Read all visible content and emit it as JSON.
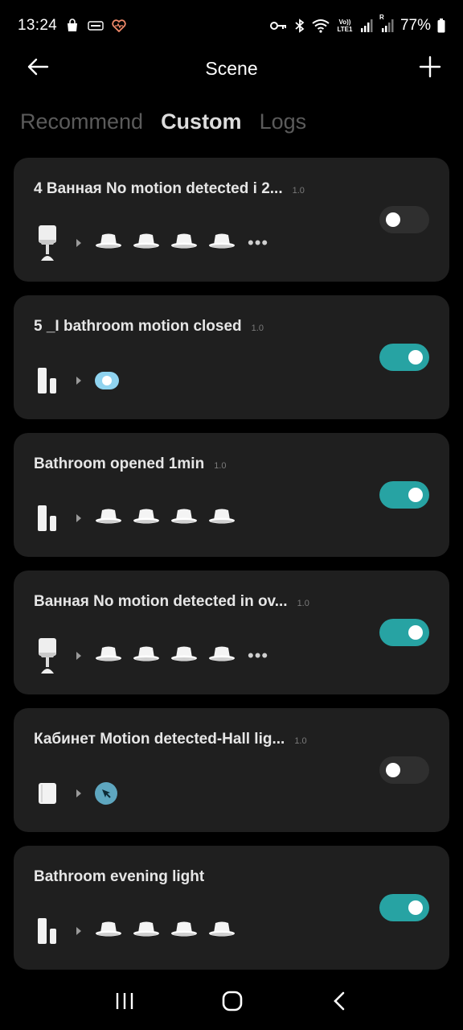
{
  "status_bar": {
    "time": "13:24",
    "battery_percent": "77%",
    "left_icons": [
      "shopping-bag-icon",
      "card-icon",
      "heart-icon"
    ],
    "right_icons": [
      "key-icon",
      "bluetooth-icon",
      "wifi-icon",
      "volte-icon",
      "signal-icon",
      "signal-roaming-icon",
      "battery-icon"
    ],
    "volte_label": "Vo)) LTE1",
    "roaming_label": "R"
  },
  "header": {
    "title": "Scene"
  },
  "tabs": [
    {
      "label": "Recommend",
      "active": false
    },
    {
      "label": "Custom",
      "active": true
    },
    {
      "label": "Logs",
      "active": false
    }
  ],
  "scenes": [
    {
      "name": "4 Ванная No motion detected i 2...",
      "version": "1.0",
      "enabled": false,
      "trigger": "motion-sensor",
      "action_type": "lights",
      "action_count": 4,
      "has_more": true
    },
    {
      "name": "5 _I bathroom motion closed",
      "version": "1.0",
      "enabled": true,
      "trigger": "door-sensor",
      "action_type": "switch",
      "action_count": 1,
      "has_more": false
    },
    {
      "name": "Bathroom opened 1min",
      "version": "1.0",
      "enabled": true,
      "trigger": "door-sensor",
      "action_type": "lights",
      "action_count": 4,
      "has_more": false
    },
    {
      "name": "Ванная No motion detected in ov...",
      "version": "1.0",
      "enabled": true,
      "trigger": "motion-sensor",
      "action_type": "lights",
      "action_count": 4,
      "has_more": true
    },
    {
      "name": "Кабинет Motion detected-Hall lig...",
      "version": "1.0",
      "enabled": false,
      "trigger": "cube-sensor",
      "action_type": "cursor",
      "action_count": 1,
      "has_more": false
    },
    {
      "name": "Bathroom evening light",
      "version": "",
      "enabled": true,
      "trigger": "door-sensor",
      "action_type": "lights",
      "action_count": 4,
      "has_more": false
    }
  ],
  "more_label": "•••",
  "colors": {
    "accent": "#27a3a3",
    "card_bg": "#1f1f1f",
    "toggle_off": "#2f2f2f"
  },
  "navbar": [
    "recent-apps-icon",
    "home-icon",
    "back-nav-icon"
  ]
}
